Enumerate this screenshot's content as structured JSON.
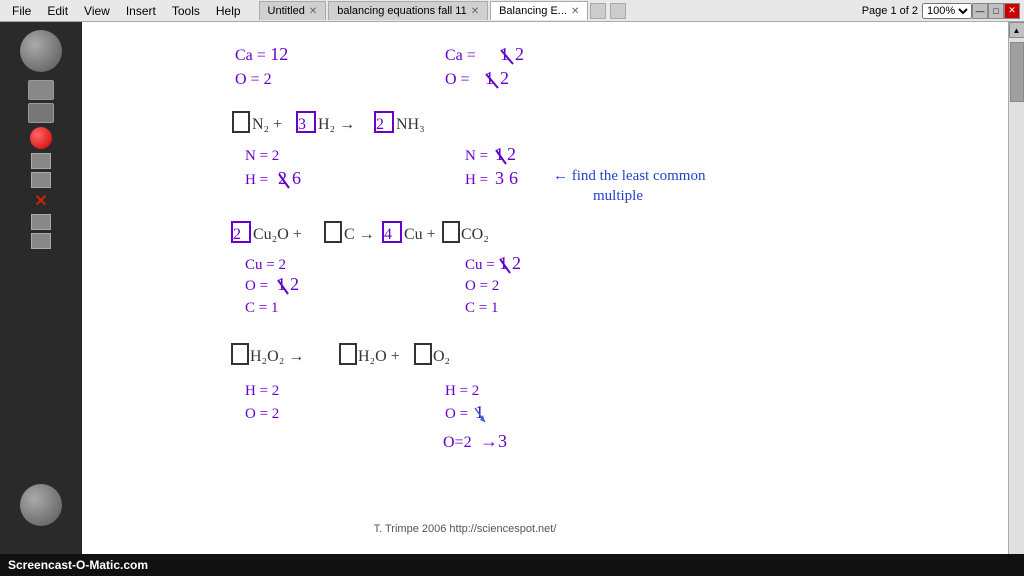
{
  "menubar": {
    "items": [
      "File",
      "Edit",
      "View",
      "Insert",
      "Tools",
      "Help"
    ],
    "tabs": [
      {
        "label": "Untitled",
        "active": false
      },
      {
        "label": "balancing equations fall 11",
        "active": false
      },
      {
        "label": "Balancing E...",
        "active": true
      }
    ],
    "page_info": "Page 1 of 2",
    "zoom": "100%"
  },
  "content": {
    "line1": {
      "ca_left": "Ca = 12",
      "o_left": "O = 2",
      "ca_right": "Ca = 12",
      "o_right": "O = 12"
    },
    "equation1": {
      "coeff1": "",
      "mol1": "N₂",
      "plus": "+",
      "coeff2": "3",
      "mol2": "H₂",
      "arrow": "→",
      "coeff3": "2",
      "mol3": "NH₃"
    },
    "line2": {
      "n_left": "N = 2",
      "h_left": "H = 2 6",
      "n_right": "N = 12",
      "h_right": "H = 3 6"
    },
    "annotation": "← find the least common\n        multiple",
    "equation2": {
      "coeff1": "2",
      "mol1": "Cu₂O",
      "plus": "+",
      "coeff2": "",
      "mol2": "C",
      "arrow": "→",
      "coeff3": "4",
      "mol3": "Cu",
      "plus2": "+",
      "coeff4": "",
      "mol4": "CO₂"
    },
    "line3": {
      "cu_left": "Cu = 2",
      "o_left": "O = 12",
      "c_left": "C = 1",
      "cu_right": "Cu = 1 2",
      "o_right": "O = 2",
      "c_right": "C = 1"
    },
    "equation3": {
      "coeff1": "",
      "mol1": "H₂O₂",
      "arrow": "→",
      "coeff2": "",
      "mol2": "H₂O",
      "plus": "+",
      "coeff3": "",
      "mol3": "O₂"
    },
    "line4": {
      "h_left": "H = 2",
      "o_left": "O = 2",
      "h_right": "H = 2",
      "o_right": "O = 1"
    },
    "note": "O = 2  → 3",
    "watermark": "T. Trimpe 2006  http://sciencespot.net/"
  },
  "bottombar": {
    "brand": "Screencast-O-Matic.com"
  },
  "icons": {
    "scroll_up": "▲",
    "scroll_down": "▼",
    "close": "✕",
    "minimize": "—",
    "maximize": "□"
  }
}
